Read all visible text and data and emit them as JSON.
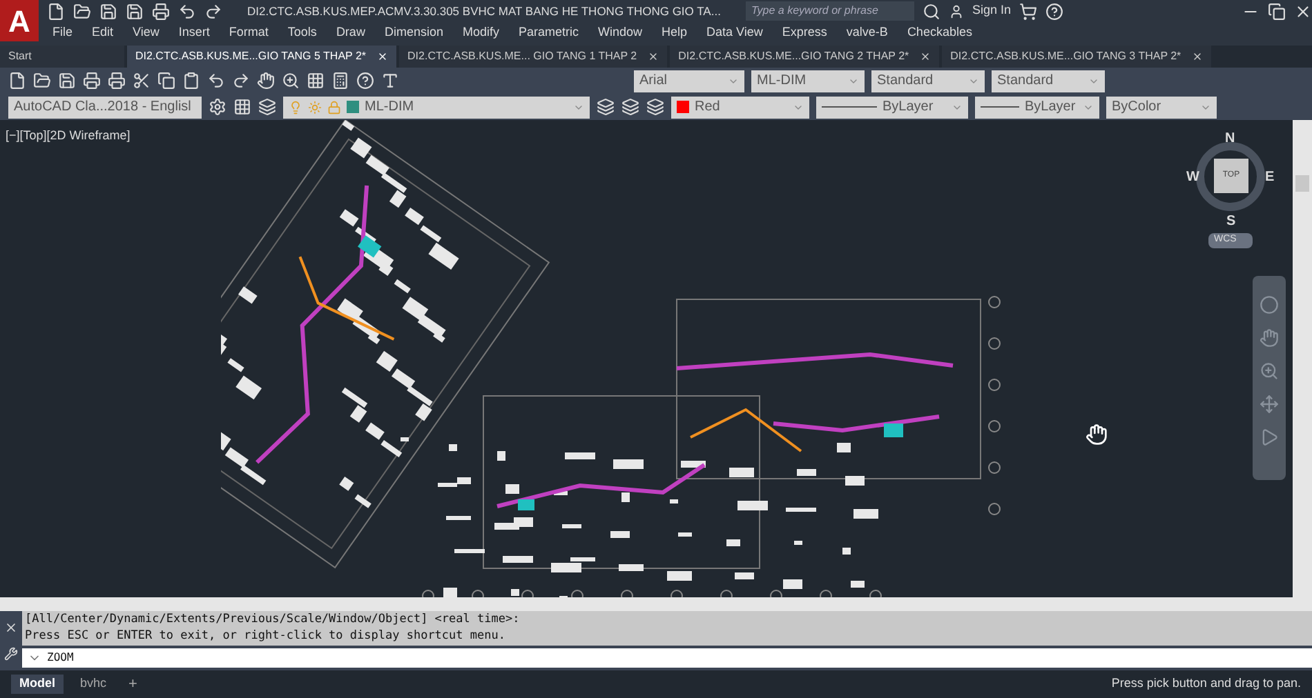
{
  "window": {
    "title": "DI2.CTC.ASB.KUS.MEP.ACMV.3.30.305 BVHC MAT BANG HE THONG THONG GIO TA...",
    "app_letter": "A"
  },
  "search": {
    "placeholder": "Type a keyword or phrase"
  },
  "sign_in": "Sign In",
  "menu": [
    "File",
    "Edit",
    "View",
    "Insert",
    "Format",
    "Tools",
    "Draw",
    "Dimension",
    "Modify",
    "Parametric",
    "Window",
    "Help",
    "Data View",
    "Express",
    "valve-B",
    "Checkables"
  ],
  "tabs": [
    {
      "label": "Start",
      "selected": false,
      "closable": false
    },
    {
      "label": "DI2.CTC.ASB.KUS.ME...GIO TANG 5 THAP 2*",
      "selected": true,
      "closable": true
    },
    {
      "label": "DI2.CTC.ASB.KUS.ME... GIO TANG 1 THAP 2",
      "selected": false,
      "closable": true
    },
    {
      "label": "DI2.CTC.ASB.KUS.ME...GIO TANG 2 THAP 2*",
      "selected": false,
      "closable": true
    },
    {
      "label": "DI2.CTC.ASB.KUS.ME...GIO TANG 3 THAP 2*",
      "selected": false,
      "closable": true
    }
  ],
  "toolbar_1": {
    "text_style": "Arial",
    "dim_style": "ML-DIM",
    "table_style": "Standard",
    "mleader_style": "Standard"
  },
  "toolbar_2": {
    "workspace": "AutoCAD Cla...2018 - Englisl",
    "layer": "ML-DIM",
    "color": {
      "label": "Red",
      "color": "#ff0000"
    },
    "linetype": "ByLayer",
    "lineweight": "ByLayer",
    "plot_style": "ByColor"
  },
  "viewport": {
    "label": "[−][Top][2D Wireframe]"
  },
  "viewcube": {
    "north": "N",
    "south": "S",
    "east": "E",
    "west": "W",
    "face": "TOP",
    "ucs": "WCS"
  },
  "command": {
    "history": [
      "[All/Center/Dynamic/Extents/Previous/Scale/Window/Object] <real time>:",
      "Press ESC or ENTER to exit, or right-click to display shortcut menu."
    ],
    "input": "ZOOM"
  },
  "layout_tabs": [
    {
      "label": "Model",
      "selected": true
    },
    {
      "label": "bvhc",
      "selected": false
    }
  ],
  "add_layout": "+",
  "status": "Press pick button and drag to pan."
}
